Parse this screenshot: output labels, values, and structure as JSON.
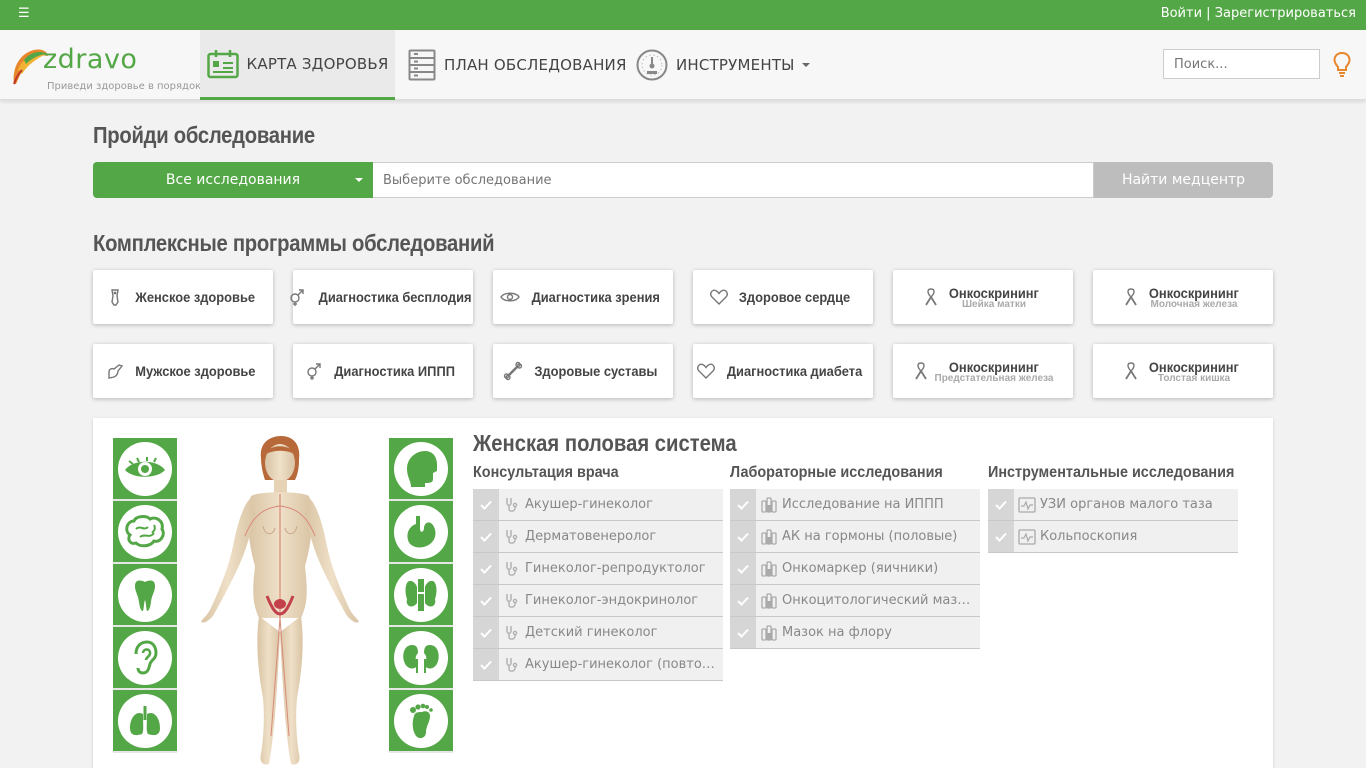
{
  "topbar": {
    "menu_icon": "hamburger-icon",
    "login": "Войти",
    "separator": "|",
    "register": "Зарегистрироваться"
  },
  "brand": {
    "name": "zdravo",
    "slogan": "Приведи здоровье в порядок"
  },
  "nav": {
    "items": [
      {
        "label": "КАРТА ЗДОРОВЬЯ",
        "icon": "health-card-icon",
        "active": true
      },
      {
        "label": "ПЛАН ОБСЛЕДОВАНИЯ",
        "icon": "plan-list-icon",
        "active": false
      },
      {
        "label": "ИНСТРУМЕНТЫ",
        "icon": "gauge-icon",
        "active": false,
        "has_dropdown": true
      }
    ],
    "search_placeholder": "Поиск..."
  },
  "exam_search": {
    "title": "Пройди обследование",
    "category": "Все исследования",
    "placeholder": "Выберите обследование",
    "button": "Найти медцентр"
  },
  "programs": {
    "title": "Комплексные программы обследований",
    "cards": [
      {
        "label": "Женское здоровье",
        "icon": "female-icon"
      },
      {
        "label": "Диагностика бесплодия",
        "icon": "gender-symbols-icon"
      },
      {
        "label": "Диагностика зрения",
        "icon": "eye-icon"
      },
      {
        "label": "Здоровое сердце",
        "icon": "heart-icon"
      },
      {
        "label": "Онкоскрининг",
        "sub": "Шейка матки",
        "icon": "ribbon-icon"
      },
      {
        "label": "Онкоскрининг",
        "sub": "Молочная железа",
        "icon": "ribbon-icon"
      },
      {
        "label": "Мужское здоровье",
        "icon": "male-icon"
      },
      {
        "label": "Диагностика ИППП",
        "icon": "gender-symbols-icon"
      },
      {
        "label": "Здоровые суставы",
        "icon": "bone-icon"
      },
      {
        "label": "Диагностика диабета",
        "icon": "heart-icon"
      },
      {
        "label": "Онкоскрининг",
        "sub": "Предстательная железа",
        "icon": "ribbon-icon"
      },
      {
        "label": "Онкоскрининг",
        "sub": "Толстая кишка",
        "icon": "ribbon-icon"
      }
    ]
  },
  "organs": {
    "left": [
      "eye-icon",
      "brain-icon",
      "tooth-icon",
      "ear-icon",
      "lungs-icon"
    ],
    "right": [
      "head-profile-icon",
      "stomach-icon",
      "thyroid-icon",
      "kidneys-icon",
      "foot-icon"
    ]
  },
  "system": {
    "title": "Женская половая система",
    "columns": [
      {
        "title": "Консультация врача",
        "row_icon": "stethoscope-icon",
        "items": [
          "Акушер-гинеколог",
          "Дерматовенеролог",
          "Гинеколог-репродуктолог",
          "Гинеколог-эндокринолог",
          "Детский гинеколог",
          "Акушер-гинеколог (повторный прием)"
        ]
      },
      {
        "title": "Лабораторные исследования",
        "row_icon": "test-tubes-icon",
        "items": [
          "Исследование на ИППП",
          "АК на гормоны (половые)",
          "Онкомаркер (яичники)",
          "Онкоцитологический мазок",
          "Мазок на флору"
        ]
      },
      {
        "title": "Инструментальные исследования",
        "row_icon": "monitor-icon",
        "items": [
          "УЗИ органов малого таза",
          "Кольпоскопия"
        ]
      }
    ]
  },
  "colors": {
    "brand_green": "#54a746",
    "disabled_gray": "#bdbdbd"
  }
}
